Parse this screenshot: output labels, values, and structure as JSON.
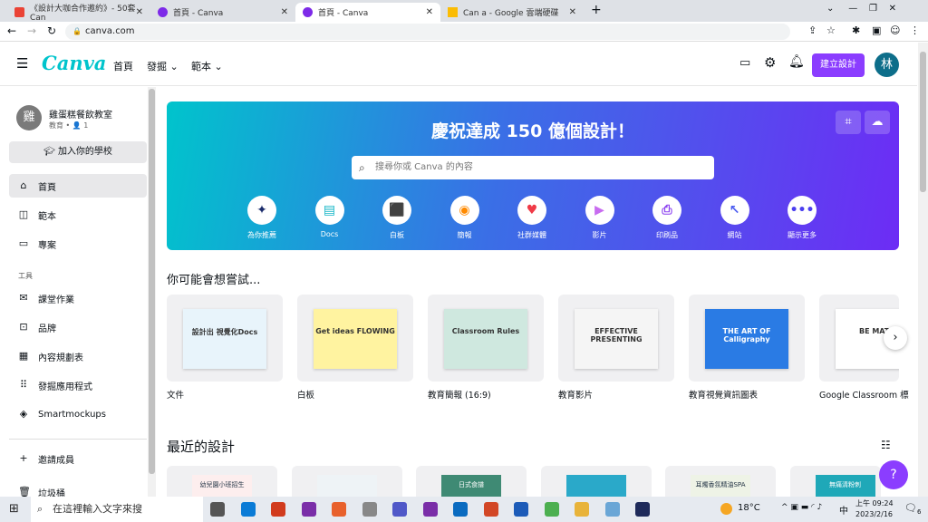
{
  "browser": {
    "tabs": [
      {
        "title": "《設計大咖合作邀約》- 50套Can"
      },
      {
        "title": "首頁 - Canva"
      },
      {
        "title": "首頁 - Canva"
      },
      {
        "title": "Can a - Google 雲端硬碟"
      }
    ],
    "url": "canva.com"
  },
  "header": {
    "logo": "Canva",
    "nav": [
      "首頁",
      "發掘",
      "範本"
    ],
    "create_button": "建立設計",
    "avatar": "林"
  },
  "sidebar": {
    "team_avatar": "雞",
    "team_name": "雞蛋糕餐飲教室",
    "team_meta": "教育 • 👤 1",
    "join_school": "加入你的學校",
    "items": [
      {
        "label": "首頁",
        "icon": "home-icon"
      },
      {
        "label": "範本",
        "icon": "template-icon"
      },
      {
        "label": "專案",
        "icon": "folder-icon"
      }
    ],
    "tools_heading": "工具",
    "tools": [
      {
        "label": "課堂作業",
        "icon": "inbox-icon"
      },
      {
        "label": "品牌",
        "icon": "brand-icon"
      },
      {
        "label": "內容規劃表",
        "icon": "calendar-icon"
      },
      {
        "label": "發掘應用程式",
        "icon": "apps-icon"
      },
      {
        "label": "Smartmockups",
        "icon": "mockup-icon"
      }
    ],
    "invite": "邀請成員",
    "trash": "垃圾桶"
  },
  "banner": {
    "title": "慶祝達成 150 億個設計！",
    "search_placeholder": "搜尋你或 Canva 的內容",
    "categories": [
      {
        "label": "為你推薦",
        "glyph": "✦",
        "color": "#1a2b6b"
      },
      {
        "label": "Docs",
        "glyph": "▤",
        "color": "#13b6c7"
      },
      {
        "label": "白板",
        "glyph": "⬛",
        "color": "#1f9d55"
      },
      {
        "label": "簡報",
        "glyph": "◉",
        "color": "#ff8a00"
      },
      {
        "label": "社群媒體",
        "glyph": "♥",
        "color": "#f03a47"
      },
      {
        "label": "影片",
        "glyph": "▶",
        "color": "#c86cf0"
      },
      {
        "label": "印刷品",
        "glyph": "⎙",
        "color": "#8a3ff0"
      },
      {
        "label": "網站",
        "glyph": "↖",
        "color": "#4b5cf0"
      },
      {
        "label": "顯示更多",
        "glyph": "•••",
        "color": "#4b3ff0"
      }
    ]
  },
  "suggest": {
    "heading": "你可能會想嘗試...",
    "cards": [
      {
        "label": "文件",
        "thumb": "設計出 視覺化Docs"
      },
      {
        "label": "白板",
        "thumb": "Get ideas FLOWING"
      },
      {
        "label": "教育簡報 (16:9)",
        "thumb": "Classroom Rules"
      },
      {
        "label": "教育影片",
        "thumb": "EFFECTIVE PRESENTING"
      },
      {
        "label": "教育視覺資訊圖表",
        "thumb": "THE ART OF Calligraphy"
      },
      {
        "label": "Google Classroom 標",
        "thumb": "BE MATH"
      }
    ]
  },
  "recent": {
    "heading": "最近的設計",
    "cards": [
      "幼兒園小班招生",
      "",
      "日式食譜",
      "",
      "耳燭香氛精油SPA",
      "無痛清粉刺"
    ]
  },
  "help": "?",
  "taskbar": {
    "search": "在這裡輸入文字來搜",
    "weather": "18°C",
    "ime": "中",
    "time": "上午 09:24",
    "date": "2023/2/16",
    "notifications": "6"
  }
}
